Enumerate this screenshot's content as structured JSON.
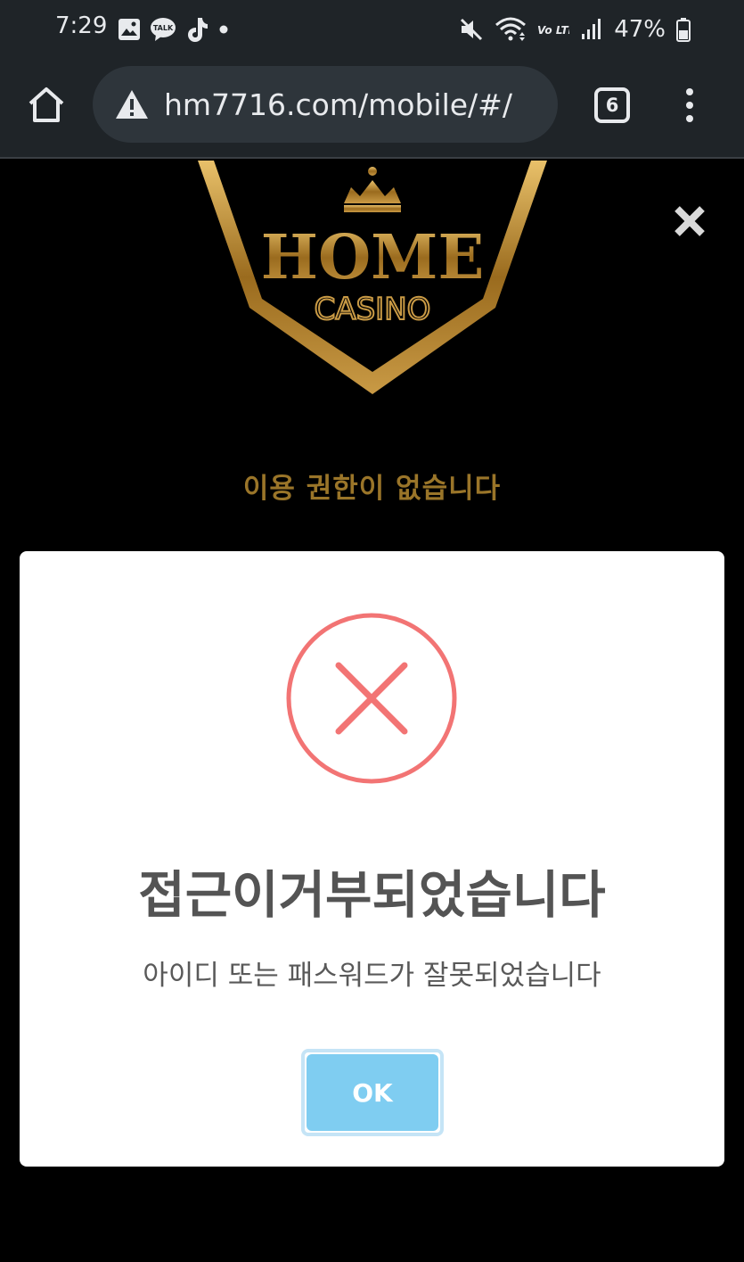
{
  "status_bar": {
    "time": "7:29",
    "left_icons": [
      "gallery-icon",
      "kakaotalk-icon",
      "tiktok-icon",
      "dot-icon"
    ],
    "kakao_label": "TALK",
    "right_icons": [
      "mute-icon",
      "wifi-icon",
      "volte-icon",
      "signal-icon",
      "battery-icon"
    ],
    "volte_label": "Vo LTE",
    "battery": "47%"
  },
  "browser": {
    "url": "hm7716.com/mobile/#/",
    "tab_count": "6"
  },
  "page": {
    "logo_line1": "HOME",
    "logo_line2": "CASINO",
    "no_permission_text": "이용 권한이 없습니다"
  },
  "dialog": {
    "title": "접근이거부되었습니다",
    "message": "아이디 또는 패스워드가 잘못되었습니다",
    "ok_label": "OK"
  },
  "colors": {
    "chrome_bg": "#1f2428",
    "gold": "#b8862a",
    "error_red": "#f27474",
    "ok_button": "#7fcdf1"
  }
}
